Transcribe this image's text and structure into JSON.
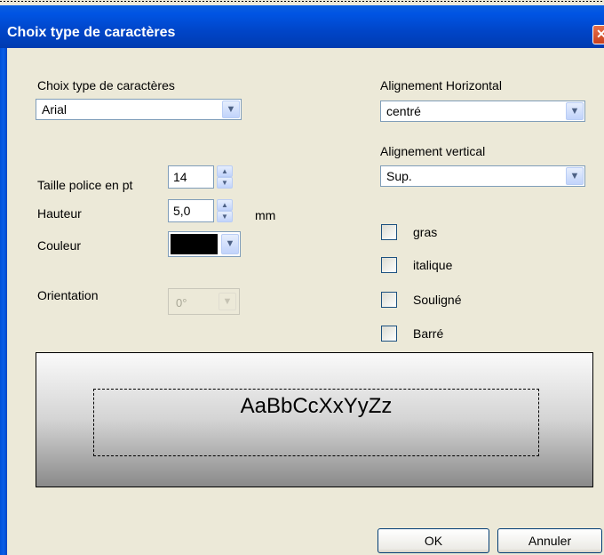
{
  "window": {
    "title": "Choix type de caractères",
    "close_glyph": "✕"
  },
  "font": {
    "label": "Choix type de caractères",
    "selected": "Arial"
  },
  "h_align": {
    "label": "Alignement Horizontal",
    "selected": "centré"
  },
  "v_align": {
    "label": "Alignement vertical",
    "selected": "Sup."
  },
  "size": {
    "label": "Taille police en pt",
    "value": "14"
  },
  "height": {
    "label": "Hauteur",
    "value": "5,0",
    "unit": "mm"
  },
  "color": {
    "label": "Couleur",
    "swatch": "#000000"
  },
  "orientation": {
    "label": "Orientation",
    "selected": "0°",
    "disabled": true
  },
  "styles": [
    {
      "label": "gras",
      "checked": false
    },
    {
      "label": "italique",
      "checked": false
    },
    {
      "label": "Souligné",
      "checked": false
    },
    {
      "label": "Barré",
      "checked": false
    }
  ],
  "preview": {
    "sample": "AaBbCcXxYyZz"
  },
  "buttons": {
    "ok": "OK",
    "cancel": "Annuler"
  },
  "colors": {
    "titlebar": "#0054e3",
    "dialog_bg": "#ece9d8",
    "field_border": "#7f9db9"
  }
}
